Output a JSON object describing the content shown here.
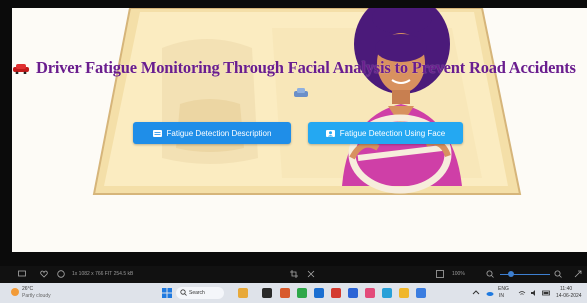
{
  "page": {
    "title": "Driver Fatigue Monitoring Through Facial Analysis to Prevent Road Accidents",
    "buttons": {
      "description": "Fatigue Detection Description",
      "face": "Fatigue Detection Using Face"
    }
  },
  "viewer_toolbar": {
    "info": "1x  1082 x 766  FIT  254.5 kB",
    "zoom": "100%"
  },
  "taskbar": {
    "weather_temp": "26°C",
    "weather_desc": "Partly cloudy",
    "search_placeholder": "Search",
    "tray_lang": "ENG",
    "tray_region": "IN",
    "time": "11:40",
    "date": "14-06-2024"
  },
  "colors": {
    "title": "#6a1d8e",
    "button_primary": "#1f8ee8",
    "button_secondary": "#24a8f2",
    "viewer_bg": "#fdfbf6",
    "frame_bg": "#0b0b0b"
  },
  "icons": [
    "car-icon",
    "document-icon",
    "user-face-icon",
    "search-icon",
    "windows-start-icon",
    "wifi-icon",
    "volume-icon",
    "battery-icon"
  ]
}
